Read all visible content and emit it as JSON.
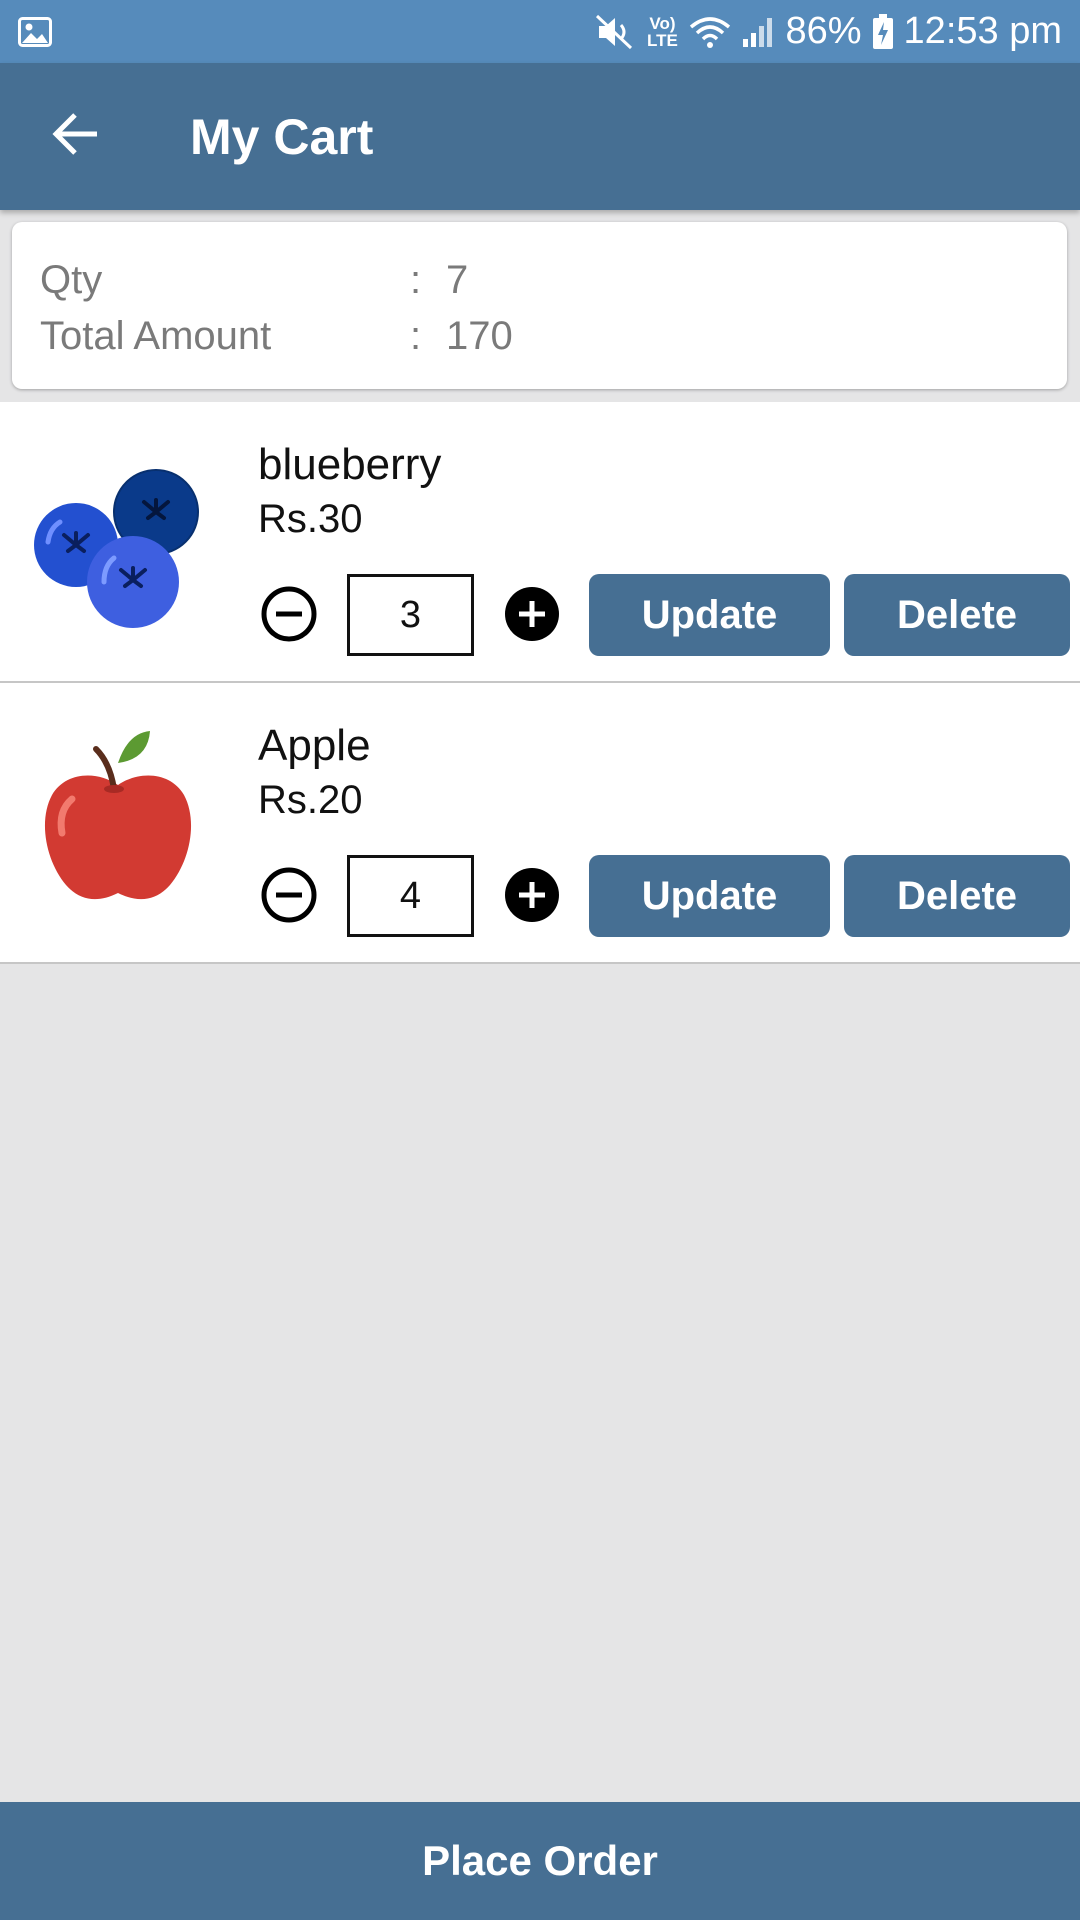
{
  "status_bar": {
    "battery": "86%",
    "time": "12:53 pm",
    "lte_label": "Vo) LTE"
  },
  "app_bar": {
    "title": "My Cart",
    "back_icon": "arrow-left-icon"
  },
  "summary": {
    "qty_label": "Qty",
    "qty_colon": ":",
    "qty_value": "7",
    "total_label": "Total Amount",
    "total_colon": ":",
    "total_value": "170"
  },
  "cart_items": [
    {
      "name": "blueberry",
      "price": "Rs.30",
      "quantity": "3",
      "image_icon": "blueberry-icon",
      "update_label": "Update",
      "delete_label": "Delete"
    },
    {
      "name": "Apple",
      "price": "Rs.20",
      "quantity": "4",
      "image_icon": "apple-icon",
      "update_label": "Update",
      "delete_label": "Delete"
    }
  ],
  "footer": {
    "place_order_label": "Place Order"
  },
  "colors": {
    "status_bar": "#568bbb",
    "primary": "#466f93",
    "background": "#e5e5e6"
  }
}
